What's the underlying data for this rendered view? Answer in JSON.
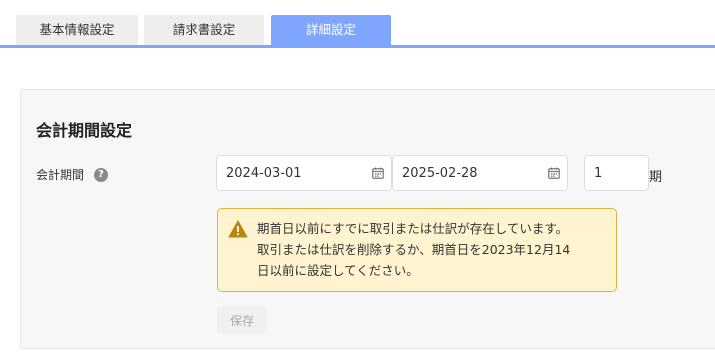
{
  "tabs": [
    {
      "label": "基本情報設定",
      "active": false
    },
    {
      "label": "請求書設定",
      "active": false
    },
    {
      "label": "詳細設定",
      "active": true
    }
  ],
  "section": {
    "title": "会計期間設定",
    "field_label": "会計期間",
    "help_icon": "question-circle-icon",
    "start_date": "2024-03-01",
    "end_date": "2025-02-28",
    "period_number": "1",
    "period_unit": "期",
    "calendar_icon": "calendar-icon"
  },
  "warning": {
    "icon": "warning-triangle-icon",
    "lines": [
      "期首日以前にすでに取引または仕訳が存在しています。",
      "取引または仕訳を削除するか、期首日を2023年12月14",
      "日以前に設定してください。"
    ]
  },
  "save_label": "保存",
  "colors": {
    "tab_active": "#7fa6ff",
    "tab_inactive": "#eeeeee",
    "warning_bg": "#fff4cf",
    "warning_border": "#e2b23a",
    "warning_icon": "#b8860b"
  }
}
